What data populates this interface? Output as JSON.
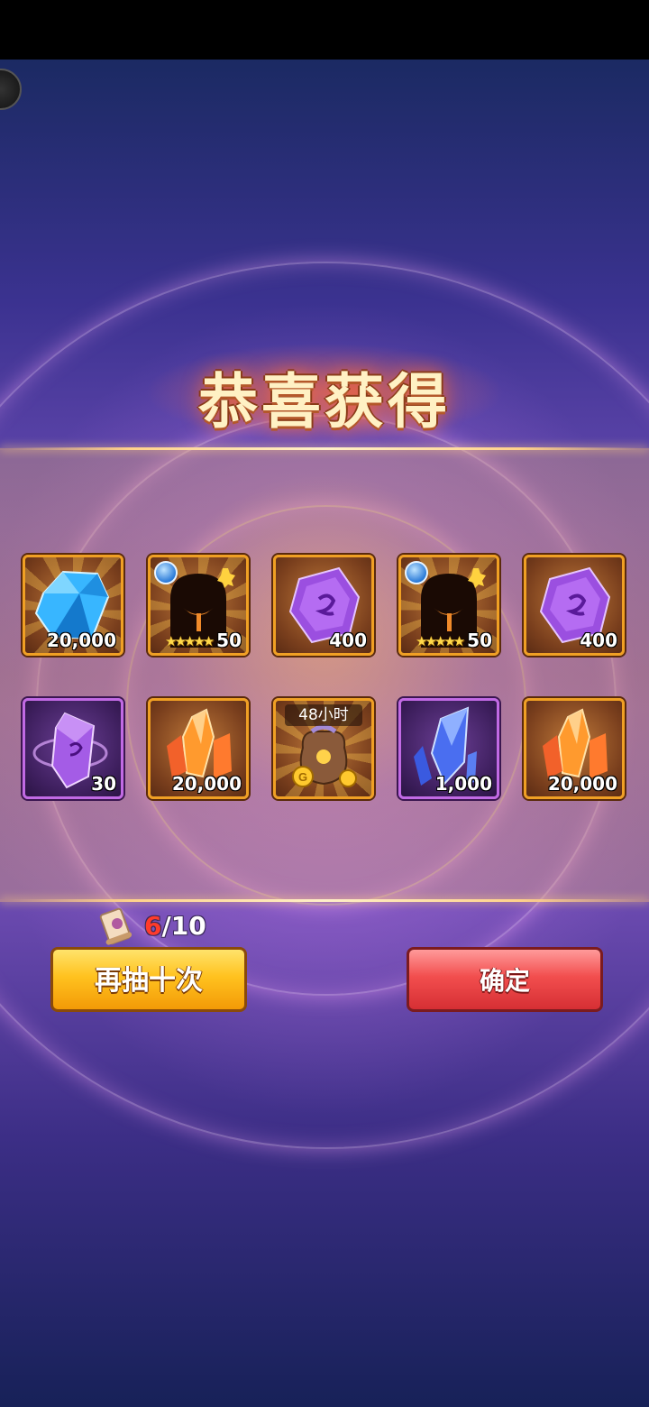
{
  "dialog": {
    "title": "恭喜获得"
  },
  "rewards": [
    {
      "name": "blue-diamond",
      "icon": "blue-diamond-icon",
      "quantity": "20,000",
      "frame": "orange"
    },
    {
      "name": "hero-shard-5star",
      "icon": "silhouette-hero-icon",
      "quantity": "50",
      "frame": "orange",
      "stars": "★★★★★",
      "element": "water"
    },
    {
      "name": "purple-gem",
      "icon": "purple-gem-icon",
      "quantity": "400",
      "frame": "orange"
    },
    {
      "name": "hero-shard-5star",
      "icon": "silhouette-hero-icon",
      "quantity": "50",
      "frame": "orange",
      "stars": "★★★★★",
      "element": "water"
    },
    {
      "name": "purple-gem",
      "icon": "purple-gem-icon",
      "quantity": "400",
      "frame": "orange"
    },
    {
      "name": "purple-rune-crystal",
      "icon": "purple-rune-icon",
      "quantity": "30",
      "frame": "purple"
    },
    {
      "name": "orange-crystal",
      "icon": "orange-crystal-icon",
      "quantity": "20,000",
      "frame": "orange"
    },
    {
      "name": "gold-bag",
      "icon": "gold-bag-icon",
      "timer": "48小时",
      "frame": "orange"
    },
    {
      "name": "blue-crystal",
      "icon": "blue-crystal-icon",
      "quantity": "1,000",
      "frame": "purple"
    },
    {
      "name": "orange-crystal",
      "icon": "orange-crystal-icon",
      "quantity": "20,000",
      "frame": "orange"
    }
  ],
  "draw_counter": {
    "current": "6",
    "total": "/10"
  },
  "buttons": {
    "draw_again": "再抽十次",
    "confirm": "确定"
  },
  "colors": {
    "orange_frame": "#f0a024",
    "purple_frame": "#c16ae4",
    "yellow_button": "#ffc21f",
    "red_button": "#f24e4e"
  }
}
